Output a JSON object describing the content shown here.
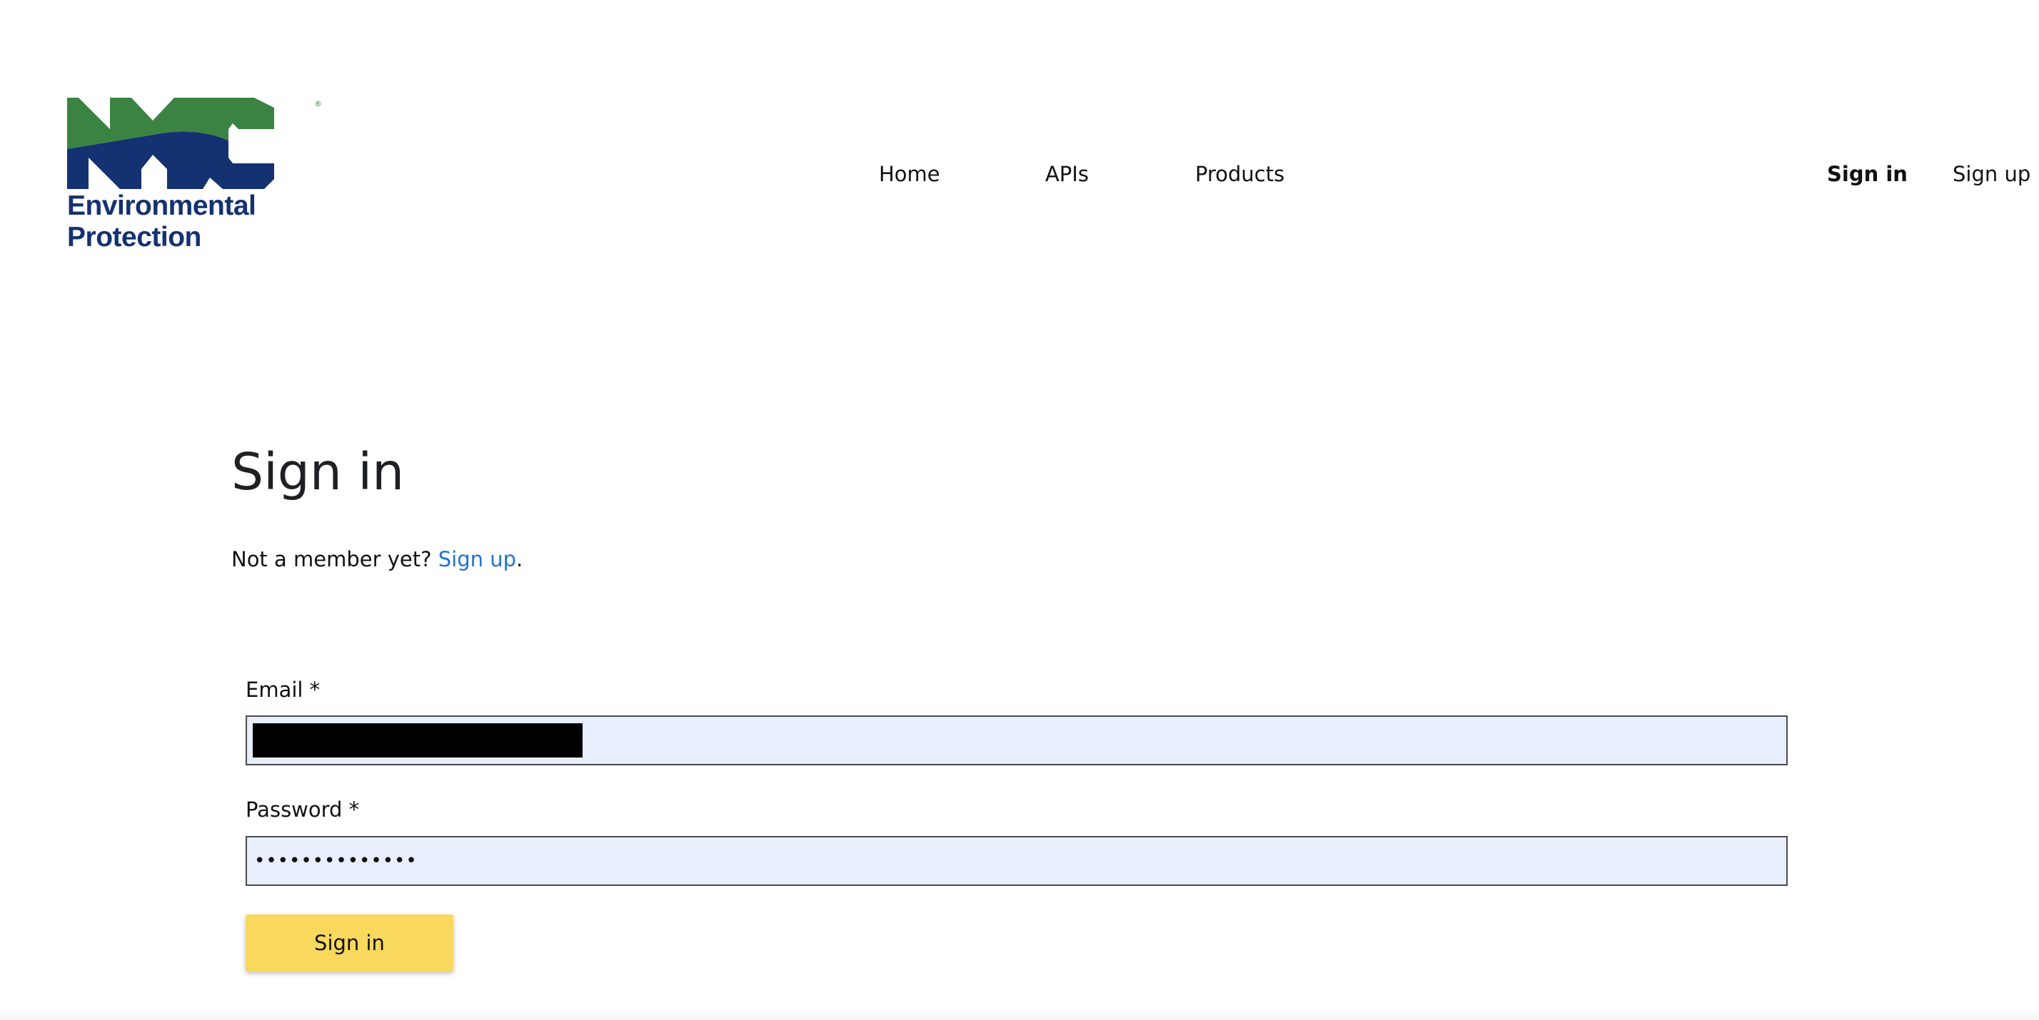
{
  "header": {
    "logo": {
      "mark": "NYC",
      "line1": "Environmental",
      "line2": "Protection",
      "colors": {
        "green": "#3a8342",
        "blue": "#143271"
      }
    },
    "nav": {
      "home": "Home",
      "apis": "APIs",
      "products": "Products"
    },
    "auth": {
      "sign_in": "Sign in",
      "sign_up": "Sign up"
    }
  },
  "main": {
    "title": "Sign in",
    "member_prompt": "Not a member yet? ",
    "member_link": "Sign up",
    "member_suffix": ".",
    "form": {
      "email_label": "Email *",
      "email_value": "",
      "password_label": "Password *",
      "password_value": "••••••••••••••",
      "submit_label": "Sign in"
    }
  },
  "colors": {
    "link": "#1f73d2",
    "input_bg": "#e8eefc",
    "button_bg": "#f9d85e"
  }
}
